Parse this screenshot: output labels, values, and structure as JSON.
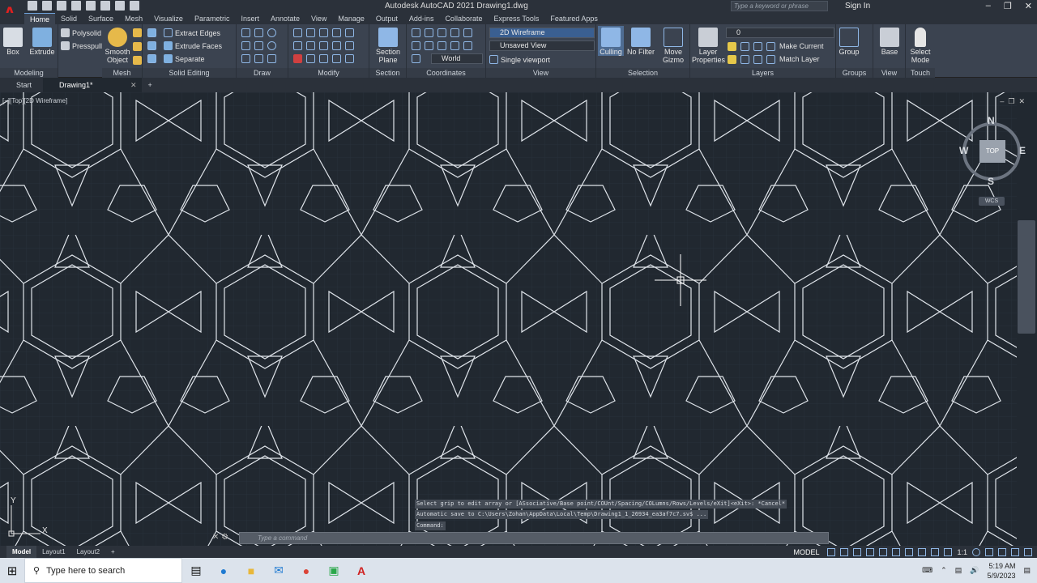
{
  "window": {
    "app_title": "Autodesk AutoCAD 2021    Drawing1.dwg",
    "search_placeholder": "Type a keyword or phrase",
    "sign_in": "Sign In"
  },
  "ribbon_tabs": [
    "Home",
    "Solid",
    "Surface",
    "Mesh",
    "Visualize",
    "Parametric",
    "Insert",
    "Annotate",
    "View",
    "Manage",
    "Output",
    "Add-ins",
    "Collaborate",
    "Express Tools",
    "Featured Apps"
  ],
  "ribbon": {
    "modeling": {
      "title": "Modeling",
      "box": "Box",
      "extrude": "Extrude",
      "polysolid": "Polysolid",
      "presspull": "Presspull"
    },
    "mesh": {
      "title": "Mesh",
      "smooth": "Smooth Object"
    },
    "solid_editing": {
      "title": "Solid Editing",
      "extract_edges": "Extract Edges",
      "extrude_faces": "Extrude Faces",
      "separate": "Separate"
    },
    "draw": {
      "title": "Draw"
    },
    "modify": {
      "title": "Modify"
    },
    "section": {
      "title": "Section",
      "section_plane": "Section Plane"
    },
    "coordinates": {
      "title": "Coordinates",
      "world": "World"
    },
    "view": {
      "title": "View",
      "visual_style": "2D Wireframe",
      "named_view": "Unsaved View",
      "viewport": "Single viewport"
    },
    "selection": {
      "title": "Selection",
      "culling": "Culling",
      "no_filter": "No Filter",
      "move_gizmo": "Move Gizmo"
    },
    "layers": {
      "title": "Layers",
      "layer_properties": "Layer Properties",
      "current_layer": "0",
      "make_current": "Make Current",
      "match_layer": "Match Layer"
    },
    "groups": {
      "title": "Groups",
      "group": "Group"
    },
    "view2": {
      "title": "View",
      "base": "Base"
    },
    "touch": {
      "title": "Touch",
      "select_mode": "Select Mode"
    }
  },
  "doc_tabs": [
    {
      "label": "Start"
    },
    {
      "label": "Drawing1*"
    }
  ],
  "viewport": {
    "label": "[−][Top][2D Wireframe]",
    "viewcube": {
      "top": "TOP",
      "n": "N",
      "s": "S",
      "e": "E",
      "w": "W",
      "wcs": "WCS"
    },
    "ucs_y": "Y",
    "ucs_x": "X"
  },
  "command": {
    "history": [
      "Select grip to edit array or [ASsociative/Base point/COUnt/Spacing/COLumns/Rows/Levels/eXit]<eXit>: *Cancel*",
      "Automatic save to C:\\Users\\Zohan\\AppData\\Local\\Temp\\Drawing1_1_26934_ea3af7c7.sv$ ...",
      "Command:"
    ],
    "placeholder": "Type a command"
  },
  "layout_tabs": [
    "Model",
    "Layout1",
    "Layout2"
  ],
  "status": {
    "model": "MODEL",
    "scale": "1:1"
  },
  "taskbar": {
    "search_placeholder": "Type here to search",
    "time": "5:19 AM",
    "date": "5/9/2023"
  },
  "colors": {
    "canvas": "#212830",
    "ribbon": "#3b4350",
    "accent": "#6fa1d9"
  }
}
